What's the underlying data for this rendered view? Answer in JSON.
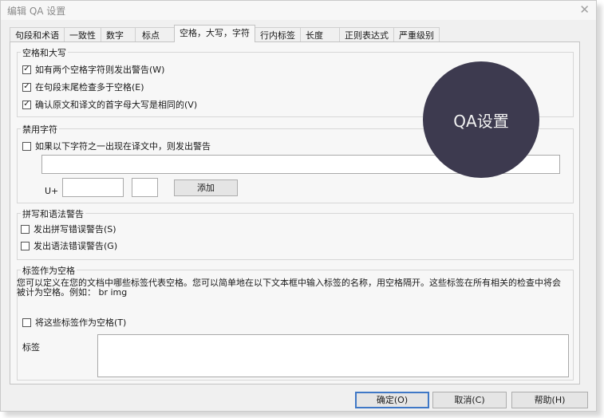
{
  "window": {
    "title": "编辑 QA 设置",
    "close_glyph": "✕"
  },
  "tabs": [
    "句段和术语",
    "一致性",
    "数字",
    "标点",
    "空格，大写，字符",
    "行内标签",
    "长度",
    "正则表达式",
    "严重级别"
  ],
  "active_tab": 4,
  "sections": {
    "spacing": {
      "legend": "空格和大写",
      "options": [
        {
          "label": "如有两个空格字符则发出警告(W)",
          "checked": true
        },
        {
          "label": "在句段末尾检查多于空格(E)",
          "checked": true
        },
        {
          "label": "确认原文和译文的首字母大写是相同的(V)",
          "checked": true
        }
      ]
    },
    "forbidden": {
      "legend": "禁用字符",
      "option": {
        "label": "如果以下字符之一出现在译文中，则发出警告",
        "checked": false
      },
      "unicode_label": "U+",
      "add_button": "添加"
    },
    "spelling": {
      "legend": "拼写和语法警告",
      "options": [
        {
          "label": "发出拼写错误警告(S)",
          "checked": false
        },
        {
          "label": "发出语法错误警告(G)",
          "checked": false
        }
      ]
    },
    "tags": {
      "legend": "标签作为空格",
      "description": "您可以定义在您的文档中哪些标签代表空格。您可以简单地在以下文本框中输入标签的名称，用空格隔开。这些标签在所有相关的检查中将会被计为空格。例如： br img",
      "option": {
        "label": "将这些标签作为空格(T)",
        "checked": false
      },
      "tags_label": "标签"
    }
  },
  "buttons": {
    "ok": "确定(O)",
    "cancel": "取消(C)",
    "help": "帮助(H)"
  },
  "overlay": {
    "text": "QA设置"
  },
  "colors": {
    "badge_bg": "#3d3a4f",
    "default_button_border": "#3f78c6"
  }
}
